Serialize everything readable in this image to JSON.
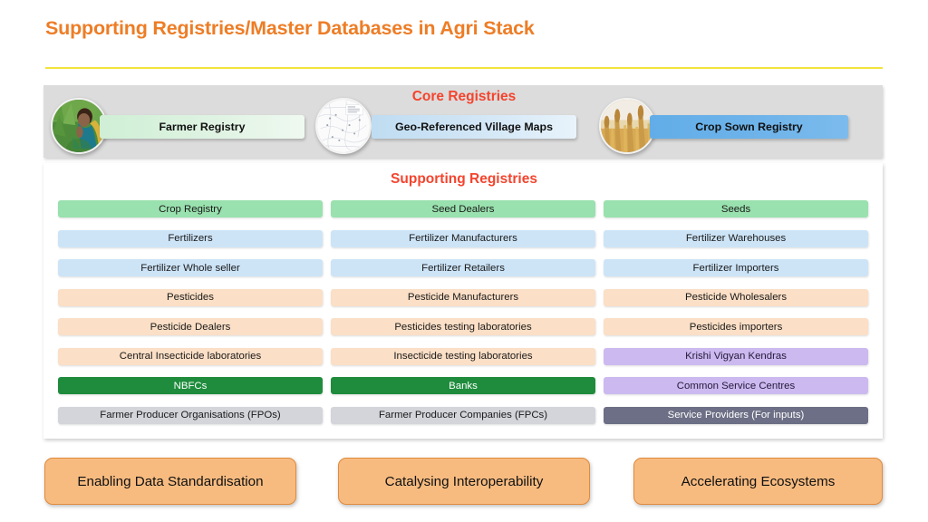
{
  "slide": {
    "title": "Supporting Registries/Master Databases in Agri Stack",
    "title_color": "#ED7D26",
    "rule_color": "#F2E33C",
    "background": "#FFFFFF"
  },
  "core_section": {
    "heading": "Core Registries",
    "heading_color": "#F4442E",
    "band_color": "#DCDCDC",
    "items": [
      {
        "label": "Farmer Registry",
        "icon": "farmer-photo-icon",
        "pill_color": "#DFF3E2"
      },
      {
        "label": "Geo-Referenced Village Maps",
        "icon": "village-map-photo-icon",
        "pill_color": "#D3E7F6"
      },
      {
        "label": "Crop Sown Registry",
        "icon": "wheat-field-photo-icon",
        "pill_color": "#6FB4EA"
      }
    ]
  },
  "supporting_section": {
    "heading": "Supporting Registries",
    "heading_color": "#F4442E",
    "columns": [
      {
        "name": "column-1",
        "rows": [
          {
            "label": "Crop Registry",
            "style": "green",
            "color": "#99E1AE"
          },
          {
            "label": "Fertilizers",
            "style": "blue",
            "color": "#CDE4F7"
          },
          {
            "label": "Fertilizer Whole seller",
            "style": "blue",
            "color": "#CDE4F7"
          },
          {
            "label": "Pesticides",
            "style": "peach",
            "color": "#FBDFC6"
          },
          {
            "label": "Pesticide Dealers",
            "style": "peach",
            "color": "#FBDFC6"
          },
          {
            "label": "Central Insecticide laboratories",
            "style": "peach",
            "color": "#FBDFC6"
          },
          {
            "label": "NBFCs",
            "style": "dgreen",
            "color": "#1E8C3C"
          },
          {
            "label": "Farmer Producer Organisations (FPOs)",
            "style": "gray",
            "color": "#D3D5DA"
          }
        ]
      },
      {
        "name": "column-2",
        "rows": [
          {
            "label": "Seed Dealers",
            "style": "green",
            "color": "#99E1AE"
          },
          {
            "label": "Fertilizer Manufacturers",
            "style": "blue",
            "color": "#CDE4F7"
          },
          {
            "label": "Fertilizer Retailers",
            "style": "blue",
            "color": "#CDE4F7"
          },
          {
            "label": "Pesticide Manufacturers",
            "style": "peach",
            "color": "#FBDFC6"
          },
          {
            "label": "Pesticides testing laboratories",
            "style": "peach",
            "color": "#FBDFC6"
          },
          {
            "label": "Insecticide testing laboratories",
            "style": "peach",
            "color": "#FBDFC6"
          },
          {
            "label": "Banks",
            "style": "dgreen",
            "color": "#1E8C3C"
          },
          {
            "label": "Farmer Producer Companies (FPCs)",
            "style": "gray",
            "color": "#D3D5DA"
          }
        ]
      },
      {
        "name": "column-3",
        "rows": [
          {
            "label": "Seeds",
            "style": "green",
            "color": "#99E1AE"
          },
          {
            "label": "Fertilizer Warehouses",
            "style": "blue",
            "color": "#CDE4F7"
          },
          {
            "label": "Fertilizer Importers",
            "style": "blue",
            "color": "#CDE4F7"
          },
          {
            "label": "Pesticide Wholesalers",
            "style": "peach",
            "color": "#FBDFC6"
          },
          {
            "label": "Pesticides importers",
            "style": "peach",
            "color": "#FBDFC6"
          },
          {
            "label": "Krishi Vigyan Kendras",
            "style": "purple",
            "color": "#CCB9F0"
          },
          {
            "label": "Common Service Centres",
            "style": "purple",
            "color": "#CCB9F0"
          },
          {
            "label": "Service Providers (For inputs)",
            "style": "slate",
            "color": "#6C6F85"
          }
        ]
      }
    ]
  },
  "callouts": {
    "fill_color": "#F7BB80",
    "border_color": "#E08A3C",
    "items": [
      {
        "label": "Enabling Data Standardisation"
      },
      {
        "label": "Catalysing Interoperability"
      },
      {
        "label": "Accelerating Ecosystems"
      }
    ]
  }
}
